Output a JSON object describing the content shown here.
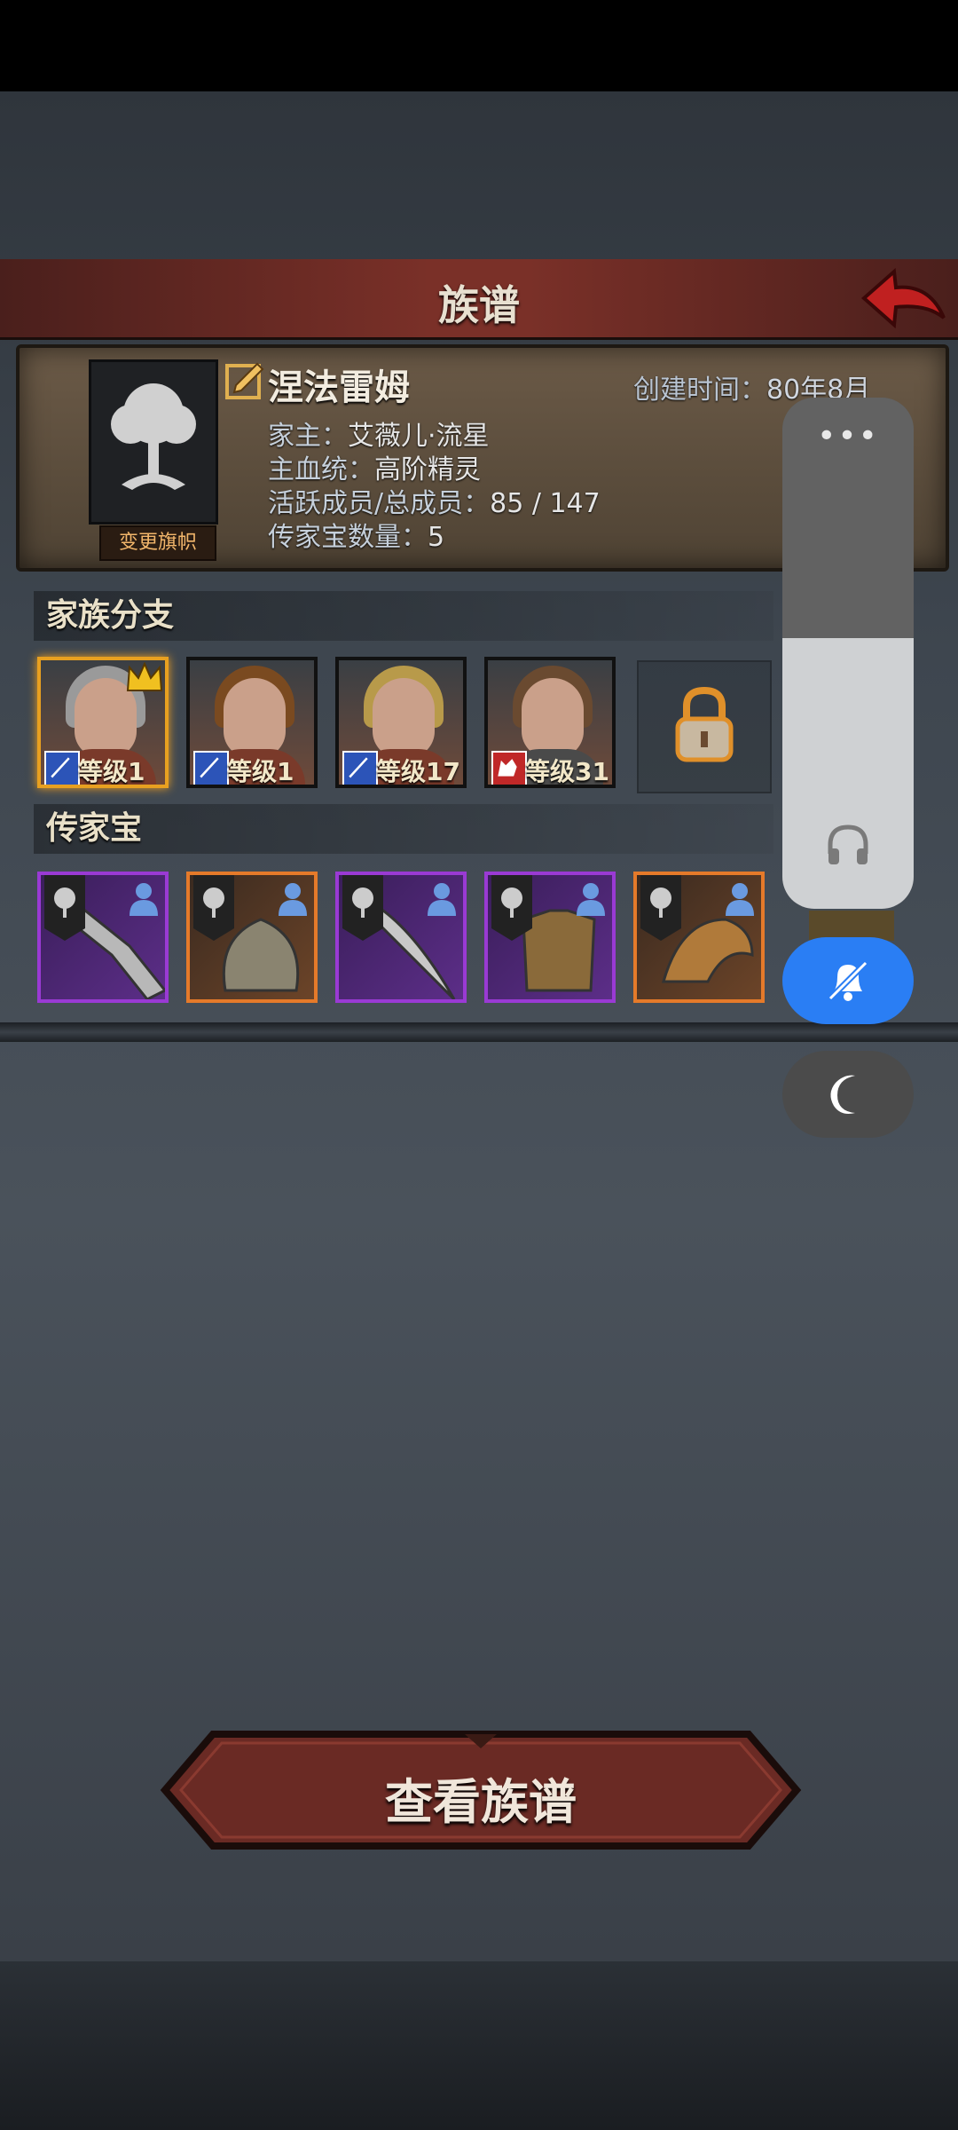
{
  "header": {
    "title": "族谱"
  },
  "family": {
    "name": "涅法雷姆",
    "created_label": "创建时间：",
    "created_value": "80年8月",
    "change_flag_label": "变更旗帜",
    "lines": [
      {
        "label": "家主：",
        "value": "艾薇儿·流星"
      },
      {
        "label": "主血统：",
        "value": "高阶精灵"
      },
      {
        "label": "活跃成员/总成员：",
        "value": "85 / 147"
      },
      {
        "label": "传家宝数量：",
        "value": "5"
      }
    ]
  },
  "branches": {
    "title": "家族分支",
    "members": [
      {
        "level": "等级1",
        "leader": true,
        "class_icon": "sword-icon",
        "hair": "#9a9a9a"
      },
      {
        "level": "等级1",
        "leader": false,
        "class_icon": "sword-icon",
        "hair": "#7a4a20"
      },
      {
        "level": "等级17",
        "leader": false,
        "class_icon": "sword-icon",
        "hair": "#b89a4a"
      },
      {
        "level": "等级31",
        "leader": false,
        "class_icon": "wolf-icon",
        "hair": "#6a4a30"
      }
    ],
    "locked_slot_icon": "lock-icon"
  },
  "heirlooms": {
    "title": "传家宝",
    "items": [
      {
        "rarity": "purple",
        "art": "gauntlet"
      },
      {
        "rarity": "orange",
        "art": "helmet"
      },
      {
        "rarity": "purple",
        "art": "blade"
      },
      {
        "rarity": "purple",
        "art": "armor"
      },
      {
        "rarity": "orange",
        "art": "dragon"
      }
    ]
  },
  "overlay": {
    "more": "•••",
    "volume_level": 0.53
  },
  "footer": {
    "view_button_label": "查看族谱"
  },
  "colors": {
    "accent_blue": "#2a7ef4",
    "rarity_purple": "#9a3ad4",
    "rarity_orange": "#e57a2a",
    "header_red": "#7a3028"
  }
}
